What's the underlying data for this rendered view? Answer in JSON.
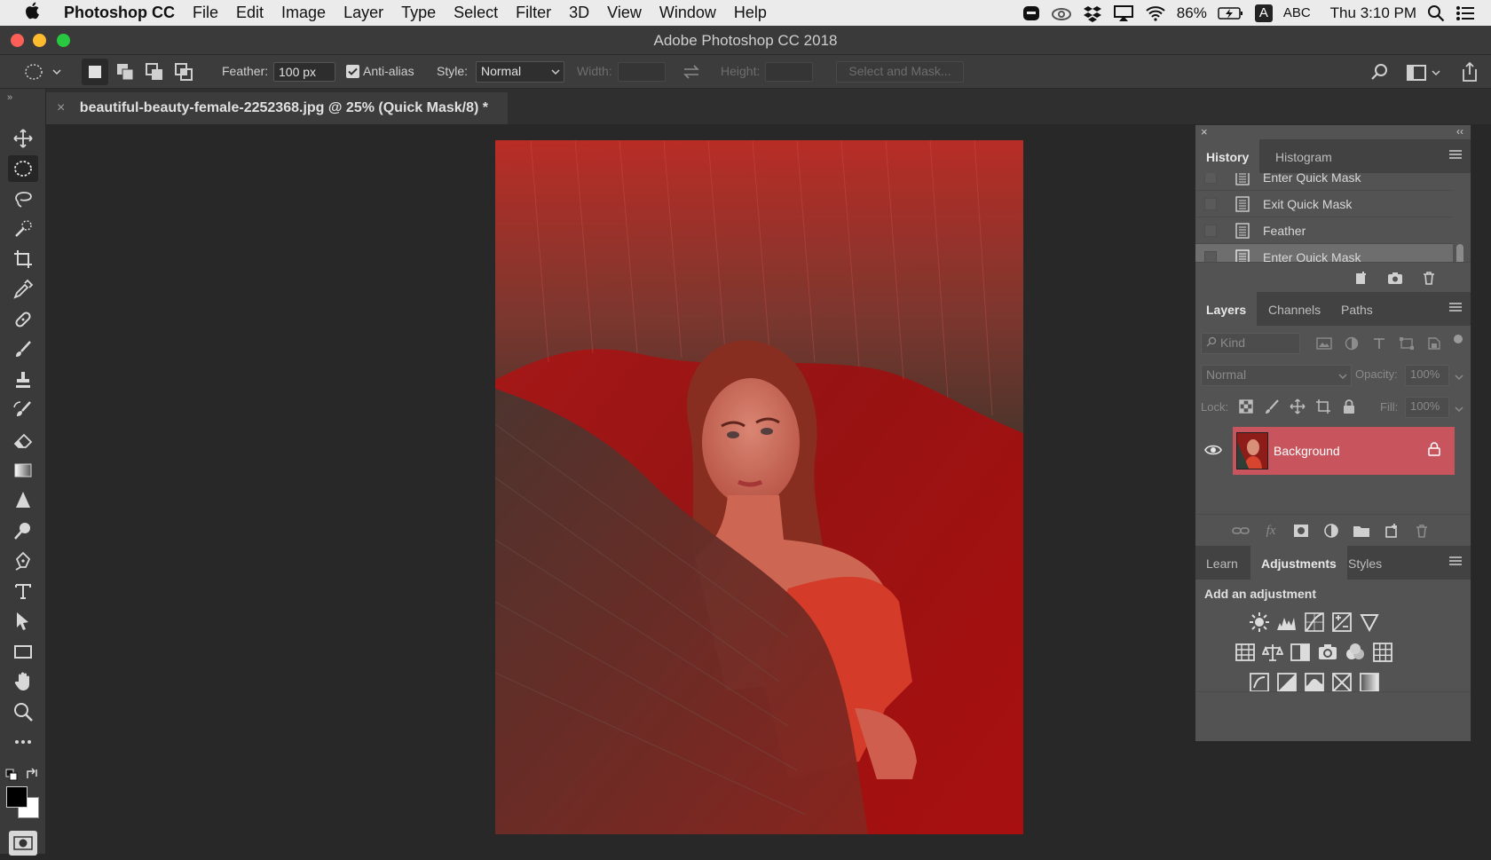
{
  "menubar": {
    "app": "Photoshop CC",
    "items": [
      "File",
      "Edit",
      "Image",
      "Layer",
      "Type",
      "Select",
      "Filter",
      "3D",
      "View",
      "Window",
      "Help"
    ],
    "battery": "86%",
    "input_source": "ABC",
    "input_badge": "A",
    "clock": "Thu 3:10 PM"
  },
  "window": {
    "title": "Adobe Photoshop CC 2018"
  },
  "options": {
    "feather_label": "Feather:",
    "feather_value": "100 px",
    "antialias_label": "Anti-alias",
    "antialias_checked": true,
    "style_label": "Style:",
    "style_value": "Normal",
    "width_label": "Width:",
    "height_label": "Height:",
    "select_mask_label": "Select and Mask..."
  },
  "document": {
    "tab_title": "beautiful-beauty-female-2252368.jpg @ 25% (Quick Mask/8) *",
    "close": "×"
  },
  "history_panel": {
    "tabs": [
      "History",
      "Histogram"
    ],
    "items": [
      {
        "label": "Enter Quick Mask",
        "active": false
      },
      {
        "label": "Exit Quick Mask",
        "active": false
      },
      {
        "label": "Feather",
        "active": false
      },
      {
        "label": "Enter Quick Mask",
        "active": true
      }
    ]
  },
  "layers_panel": {
    "tabs": [
      "Layers",
      "Channels",
      "Paths"
    ],
    "kind_placeholder": "Kind",
    "blend_mode": "Normal",
    "opacity_label": "Opacity:",
    "opacity_value": "100%",
    "lock_label": "Lock:",
    "fill_label": "Fill:",
    "fill_value": "100%",
    "layers": [
      {
        "name": "Background",
        "visible": true,
        "locked": true
      }
    ]
  },
  "adjustments_panel": {
    "tabs": [
      "Learn",
      "Adjustments",
      "Styles"
    ],
    "heading": "Add an adjustment"
  },
  "colors": {
    "accent": "#c8555e",
    "quick_mask": "#b01818"
  }
}
